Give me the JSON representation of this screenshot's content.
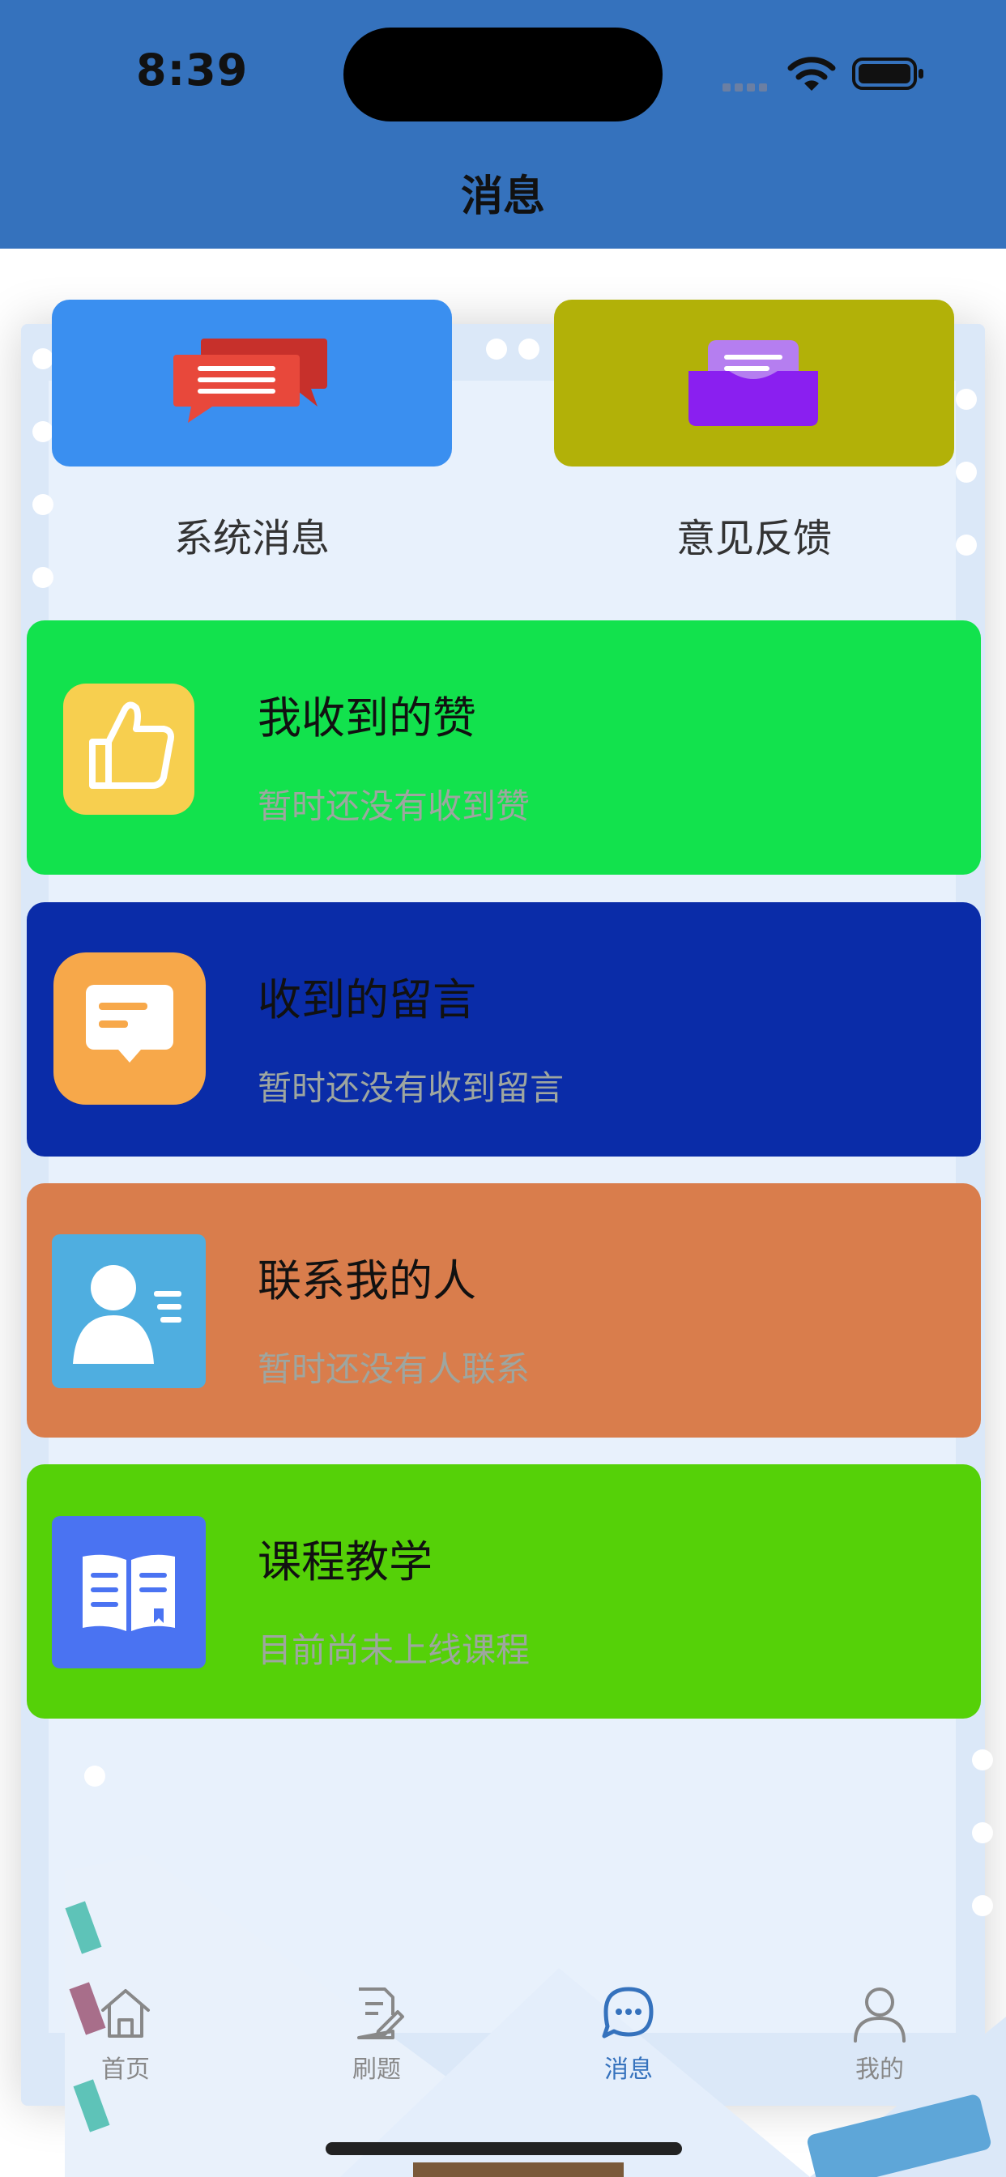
{
  "status_bar": {
    "time": "8:39"
  },
  "header": {
    "title": "消息"
  },
  "tiles": [
    {
      "label": "系统消息",
      "icon": "chat-bubbles-icon",
      "color": "#3a8ff0"
    },
    {
      "label": "意见反馈",
      "icon": "envelope-icon",
      "color": "#b2b108"
    }
  ],
  "cards": [
    {
      "title": "我收到的赞",
      "subtitle": "暂时还没有收到赞",
      "icon": "thumbs-up-icon",
      "color": "#12e24d"
    },
    {
      "title": "收到的留言",
      "subtitle": "暂时还没有收到留言",
      "icon": "message-icon",
      "color": "#0a2ca8"
    },
    {
      "title": "联系我的人",
      "subtitle": "暂时还没有人联系",
      "icon": "contact-card-icon",
      "color": "#d97d4c"
    },
    {
      "title": "课程教学",
      "subtitle": "目前尚未上线课程",
      "icon": "book-icon",
      "color": "#55d108"
    }
  ],
  "tabbar": {
    "items": [
      {
        "label": "首页",
        "icon": "home-icon",
        "active": false
      },
      {
        "label": "刷题",
        "icon": "edit-document-icon",
        "active": false
      },
      {
        "label": "消息",
        "icon": "chat-icon",
        "active": true
      },
      {
        "label": "我的",
        "icon": "person-icon",
        "active": false
      }
    ],
    "active_color": "#3572bd"
  }
}
